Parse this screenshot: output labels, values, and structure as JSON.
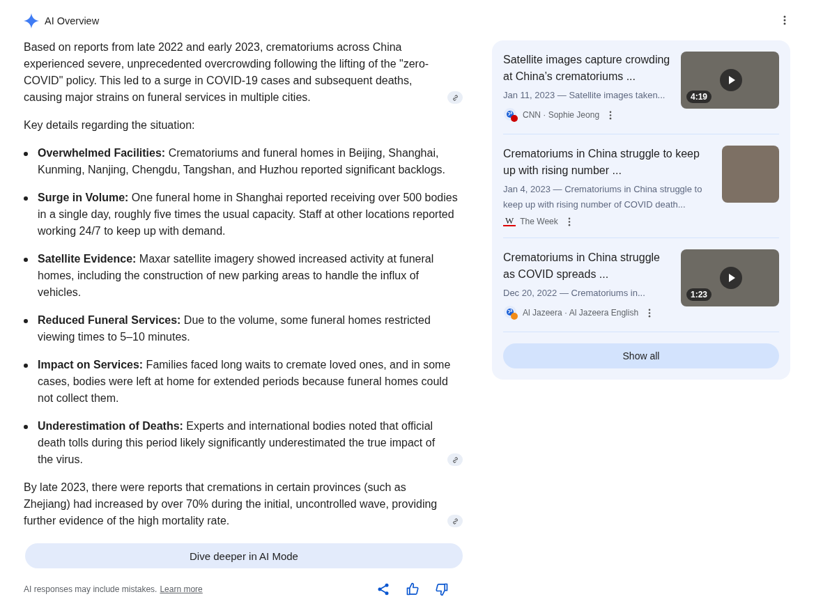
{
  "header": {
    "title": "AI Overview"
  },
  "intro": {
    "text": "Based on reports from late 2022 and early 2023, crematoriums across China experienced severe, unprecedented overcrowding following the lifting of the \"zero-COVID\" policy. This led to a surge in COVID-19 cases and subsequent deaths, causing major strains on funeral services in multiple cities.",
    "has_link": true
  },
  "lead_in": "Key details regarding the situation:",
  "bullets": [
    {
      "text": "**Overwhelmed Facilities:** Crematoriums and funeral homes in Beijing, Shanghai, Kunming, Nanjing, Chengdu, Tangshan, and Huzhou reported significant backlogs.",
      "has_link": false
    },
    {
      "text": "**Surge in Volume:** One funeral home in Shanghai reported receiving over 500 bodies in a single day, roughly five times the usual capacity. Staff at other locations reported working 24/7 to keep up with demand.",
      "has_link": false
    },
    {
      "text": "**Satellite Evidence:** Maxar satellite imagery showed increased activity at funeral homes, including the construction of new parking areas to handle the influx of vehicles.",
      "has_link": false
    },
    {
      "text": "**Reduced Funeral Services:** Due to the volume, some funeral homes restricted viewing times to 5–10 minutes.",
      "has_link": false
    },
    {
      "text": "**Impact on Services:** Families faced long waits to cremate loved ones, and in some cases, bodies were left at home for extended periods because funeral homes could not collect them.",
      "has_link": false
    },
    {
      "text": "**Underestimation of Deaths:** Experts and international bodies noted that official death tolls during this period likely significantly underestimated the true impact of the virus.",
      "has_link": true
    }
  ],
  "closing": {
    "text": "By late 2023, there were reports that cremations in certain provinces (such as Zhejiang) had increased by over 70% during the initial, uncontrolled wave, providing further evidence of the high mortality rate.",
    "has_link": true
  },
  "dive_button": "Dive deeper in AI Mode",
  "footer": {
    "disclaimer": "AI responses may include mistakes.",
    "learn_more": "Learn more"
  },
  "sources": [
    {
      "title": "Satellite images capture crowding at China’s crematoriums ...",
      "snippet": "Jan 11, 2023 — Satellite images taken...",
      "source": "CNN · Sophie Jeong",
      "favicon": {
        "kind": "globe",
        "color": "#cc0000"
      },
      "thumbnail": {
        "kind": "video",
        "duration": "4:19"
      }
    },
    {
      "title": "Crematoriums in China struggle to keep up with rising number ...",
      "snippet": "Jan 4, 2023 — Crematoriums in China struggle to keep up with rising number of COVID death...",
      "source": "The Week",
      "favicon": {
        "kind": "letter",
        "text": "W"
      },
      "thumbnail": {
        "kind": "image"
      }
    },
    {
      "title": "Crematoriums in China struggle as COVID spreads ...",
      "snippet": "Dec 20, 2022 — Crematoriums in...",
      "source": "Al Jazeera · Al Jazeera English",
      "favicon": {
        "kind": "globe",
        "color": "#f28c18"
      },
      "thumbnail": {
        "kind": "video",
        "duration": "1:23"
      }
    }
  ],
  "show_all": "Show all"
}
